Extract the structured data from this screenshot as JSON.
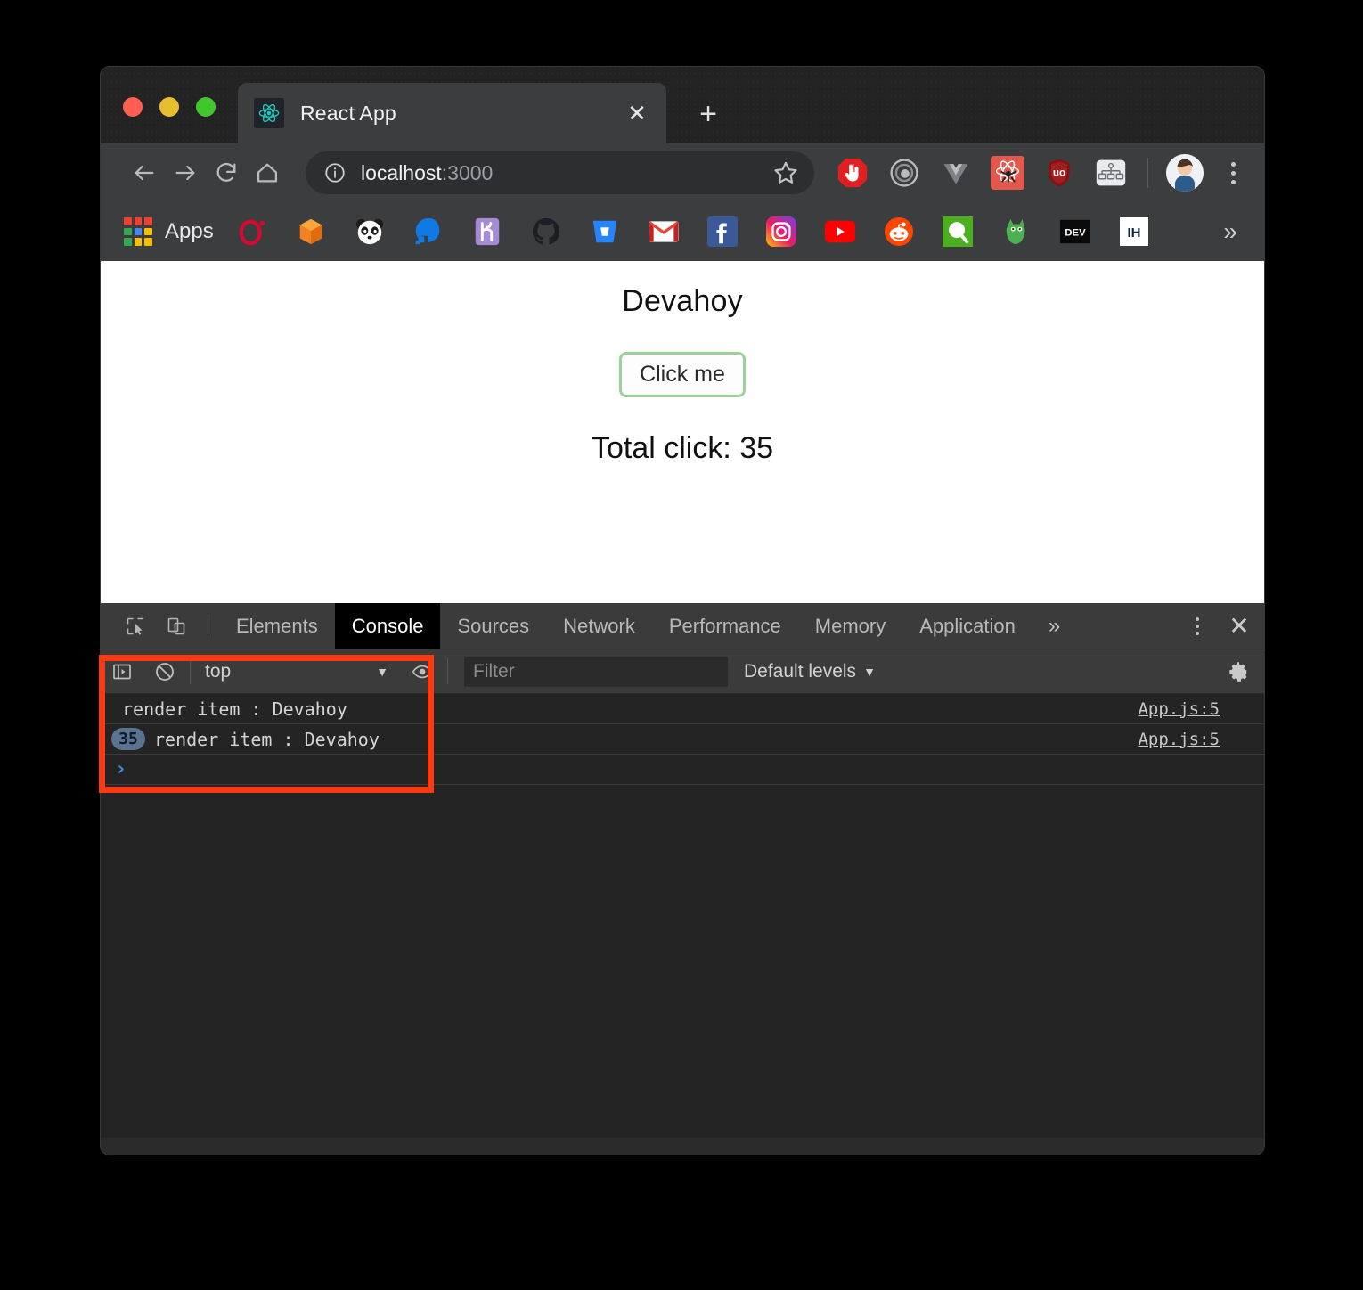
{
  "browser": {
    "tab": {
      "title": "React App",
      "favicon": "react-logo-icon",
      "close_label": "✕"
    },
    "new_tab_label": "+",
    "nav": {
      "back": "back-arrow-icon",
      "forward": "forward-arrow-icon",
      "reload": "reload-icon",
      "home": "home-icon"
    },
    "omnibox": {
      "info_icon": "info-circle-icon",
      "url_host": "localhost",
      "url_port": ":3000",
      "star_icon": "bookmark-star-icon"
    },
    "extensions": [
      {
        "name": "adblock-icon",
        "title": "AdBlock"
      },
      {
        "name": "target-icon",
        "title": "Extension"
      },
      {
        "name": "vue-devtools-icon",
        "title": "Vue.js devtools"
      },
      {
        "name": "react-devtools-icon",
        "title": "React Developer Tools"
      },
      {
        "name": "ublock-origin-icon",
        "title": "uBlock Origin"
      },
      {
        "name": "sitemap-icon",
        "title": "Sitemap"
      }
    ],
    "profile_avatar": "user-avatar",
    "menu_icon": "chrome-menu-icon",
    "bookmarks": {
      "apps_label": "Apps",
      "items": [
        {
          "name": "opera-bookmark-icon"
        },
        {
          "name": "box-bookmark-icon"
        },
        {
          "name": "panda-bookmark-icon"
        },
        {
          "name": "digitalocean-bookmark-icon"
        },
        {
          "name": "heroku-bookmark-icon"
        },
        {
          "name": "github-bookmark-icon"
        },
        {
          "name": "bitbucket-bookmark-icon"
        },
        {
          "name": "gmail-bookmark-icon"
        },
        {
          "name": "facebook-bookmark-icon"
        },
        {
          "name": "instagram-bookmark-icon"
        },
        {
          "name": "youtube-bookmark-icon"
        },
        {
          "name": "reddit-bookmark-icon"
        },
        {
          "name": "qualtrics-bookmark-icon"
        },
        {
          "name": "gitlab-bookmark-icon"
        },
        {
          "name": "dev-to-bookmark-icon",
          "text": "DEV"
        },
        {
          "name": "indiehackers-bookmark-icon",
          "text": "IH"
        }
      ],
      "overflow_label": "»"
    }
  },
  "page": {
    "heading": "Devahoy",
    "button_label": "Click me",
    "counter_text": "Total click: 35",
    "button_border_color": "#9ed19a"
  },
  "devtools": {
    "tools": {
      "inspect": "inspect-element-icon",
      "device_toolbar": "device-toolbar-icon"
    },
    "tabs": [
      {
        "label": "Elements",
        "active": false
      },
      {
        "label": "Console",
        "active": true
      },
      {
        "label": "Sources",
        "active": false
      },
      {
        "label": "Network",
        "active": false
      },
      {
        "label": "Performance",
        "active": false
      },
      {
        "label": "Memory",
        "active": false
      },
      {
        "label": "Application",
        "active": false
      }
    ],
    "more_tabs_label": "»",
    "kebab_menu": "devtools-more-options-icon",
    "close_label": "✕",
    "console_toolbar": {
      "sidebar_toggle": "console-sidebar-icon",
      "clear_console": "clear-console-icon",
      "context": "top",
      "context_caret": "▼",
      "live_expression": "eye-icon",
      "filter_placeholder": "Filter",
      "filter_value": "",
      "levels_label": "Default levels",
      "levels_caret": "▼",
      "settings": "settings-gear-icon"
    },
    "console_messages": [
      {
        "count": "",
        "text": "render item :  Devahoy",
        "source": "App.js:5"
      },
      {
        "count": "35",
        "text": "render item :  Devahoy",
        "source": "App.js:5"
      }
    ],
    "prompt_caret": "›"
  },
  "annotation": {
    "color": "#fc3a12",
    "name": "red-highlight-rectangle"
  }
}
